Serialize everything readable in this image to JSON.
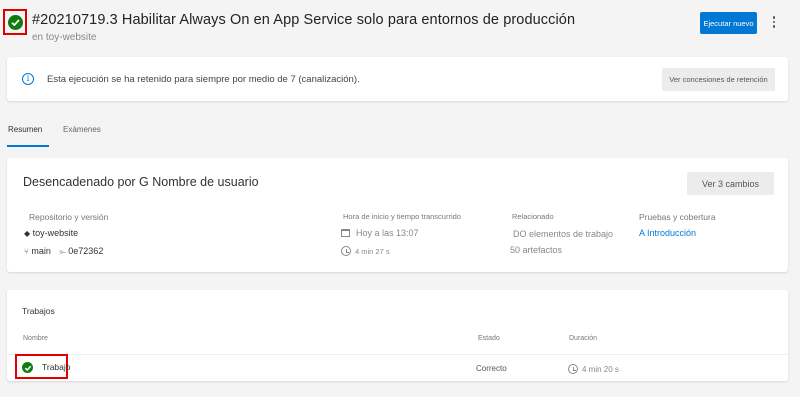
{
  "header": {
    "title": "#20210719.3 Habilitar Always On en App Service solo para entornos de producción",
    "subtitle": "en toy-website",
    "run_button": "Ejecutar nuevo",
    "status": "success"
  },
  "banner": {
    "text": "Esta ejecución se ha retenido para siempre por medio de 7 (canalización).",
    "grants_button": "Ver concesiones de retención"
  },
  "tabs": [
    {
      "label": "Resumen"
    },
    {
      "label": "Exámenes"
    }
  ],
  "summary": {
    "trigger": "Desencadenado por G Nombre de usuario",
    "changes_button": "Ver 3 cambios",
    "repo_header": "Repositorio y versión",
    "repo_name": "toy-website",
    "branch": "main",
    "commit": "0e72362",
    "time_header": "Hora de inicio y tiempo transcurrido",
    "start_time": "Hoy a las 13:07",
    "elapsed": "4 min 27 s",
    "related_header": "Relacionado",
    "work_items": "DO elementos de trabajo",
    "artifacts": "50 artefactos",
    "tests_header": "Pruebas y cobertura",
    "tests_link": "A Introducción"
  },
  "jobs": {
    "title": "Trabajos",
    "columns": [
      "Nombre",
      "Estado",
      "Duración"
    ],
    "rows": [
      {
        "name": "Trabajo",
        "status": "Correcto",
        "duration": "4 min 20 s"
      }
    ]
  },
  "colors": {
    "accent": "#0078d4",
    "success": "#107c10",
    "highlight": "#e00000"
  }
}
